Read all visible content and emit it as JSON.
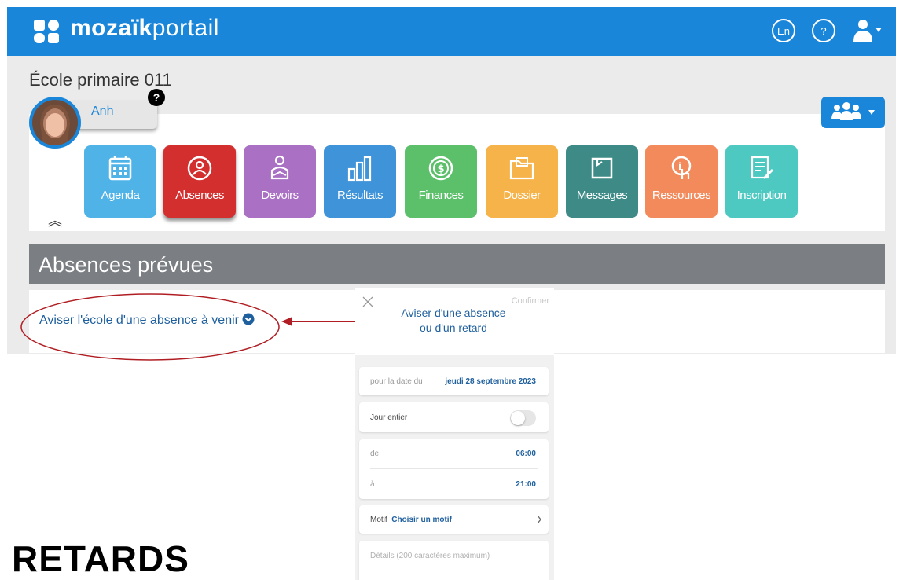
{
  "header": {
    "brand_bold": "mozaïk",
    "brand_light": "portail",
    "lang_label": "En",
    "help_label": "?"
  },
  "school": {
    "name": "École primaire 011",
    "student_name": "Anh",
    "help_badge": "?"
  },
  "tiles": [
    {
      "label": "Agenda",
      "color": "#4fb3e8",
      "icon": "calendar-icon"
    },
    {
      "label": "Absences",
      "color": "#d32f2f",
      "icon": "absence-person-icon"
    },
    {
      "label": "Devoirs",
      "color": "#a970c4",
      "icon": "homework-reading-icon"
    },
    {
      "label": "Résultats",
      "color": "#3f93d8",
      "icon": "bar-chart-icon"
    },
    {
      "label": "Finances",
      "color": "#5cc06b",
      "icon": "dollar-coin-icon"
    },
    {
      "label": "Dossier",
      "color": "#f6b34a",
      "icon": "folder-icon"
    },
    {
      "label": "Messages",
      "color": "#3d8a87",
      "icon": "message-icon"
    },
    {
      "label": "Ressources",
      "color": "#f28a5c",
      "icon": "resource-hand-icon"
    },
    {
      "label": "Inscription",
      "color": "#4ec9c2",
      "icon": "form-edit-icon"
    }
  ],
  "section": {
    "title": "Absences prévues",
    "notify_link": "Aviser l'école d'une absence à venir"
  },
  "modal": {
    "confirm": "Confirmer",
    "title": "Aviser d'une absence ou d'un retard",
    "date_label": "pour la date du",
    "date_value": "jeudi 28 septembre 2023",
    "full_day_label": "Jour entier",
    "full_day_on": false,
    "from_label": "de",
    "from_value": "06:00",
    "to_label": "à",
    "to_value": "21:00",
    "reason_label": "Motif",
    "reason_value": "Choisir un motif",
    "details_placeholder": "Détails (200 caractères maximum)"
  },
  "footer_heading": "RETARDS",
  "colors": {
    "brand_blue": "#1a86d9",
    "link_blue": "#1e5f9e",
    "section_gray": "#7b7f83",
    "annotation_red": "#b01e23"
  }
}
